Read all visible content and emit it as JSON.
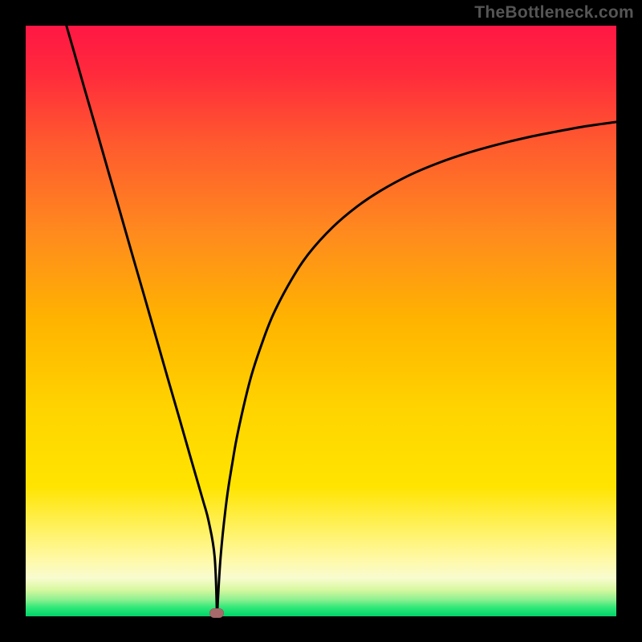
{
  "watermark": "TheBottleneck.com",
  "chart_data": {
    "type": "line",
    "title": "",
    "xlabel": "",
    "ylabel": "",
    "x_range": [
      0,
      100
    ],
    "y_range": [
      0,
      100
    ],
    "background_gradient": {
      "stops": [
        {
          "pos": 0.0,
          "color": "#ff1744"
        },
        {
          "pos": 0.08,
          "color": "#ff2a3c"
        },
        {
          "pos": 0.2,
          "color": "#ff5a2e"
        },
        {
          "pos": 0.35,
          "color": "#ff8a1e"
        },
        {
          "pos": 0.5,
          "color": "#ffb400"
        },
        {
          "pos": 0.65,
          "color": "#ffd400"
        },
        {
          "pos": 0.78,
          "color": "#ffe400"
        },
        {
          "pos": 0.86,
          "color": "#fff36b"
        },
        {
          "pos": 0.905,
          "color": "#fff9a8"
        },
        {
          "pos": 0.935,
          "color": "#f8fccf"
        },
        {
          "pos": 0.955,
          "color": "#d8f8a0"
        },
        {
          "pos": 0.972,
          "color": "#8cf090"
        },
        {
          "pos": 0.985,
          "color": "#30e878"
        },
        {
          "pos": 1.0,
          "color": "#00d46a"
        }
      ]
    },
    "curve_left": {
      "x": [
        6.9,
        8,
        10,
        12,
        14,
        16,
        18,
        20,
        22,
        24,
        26,
        28,
        30,
        31,
        32,
        32.4
      ],
      "y": [
        100,
        96.2,
        89.2,
        82.3,
        75.3,
        68.4,
        61.4,
        54.5,
        47.5,
        40.5,
        33.6,
        26.6,
        19.7,
        16.0,
        10.0,
        0
      ]
    },
    "curve_right": {
      "x": [
        32.4,
        33,
        34,
        35,
        36,
        38,
        40,
        42,
        45,
        48,
        52,
        56,
        60,
        65,
        70,
        75,
        80,
        85,
        90,
        95,
        100
      ],
      "y": [
        0,
        10.0,
        19.5,
        26.0,
        31.5,
        40.0,
        46.2,
        51.3,
        57.0,
        61.5,
        65.9,
        69.3,
        72.0,
        74.7,
        76.8,
        78.5,
        79.9,
        81.1,
        82.1,
        83.0,
        83.7
      ]
    },
    "marker": {
      "x": 32.3,
      "y": 0.5,
      "color": "#a76a6a"
    },
    "stroke": {
      "color": "#000000",
      "width": 3
    }
  }
}
